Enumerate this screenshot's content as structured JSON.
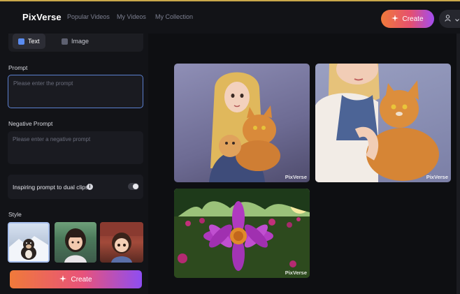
{
  "header": {
    "logo": "PixVerse",
    "nav": [
      "Popular Videos",
      "My Videos",
      "My Collection"
    ],
    "create_label": "Create"
  },
  "mode_tabs": [
    {
      "label": "Text",
      "selected": true
    },
    {
      "label": "Image",
      "selected": false
    }
  ],
  "prompt": {
    "label": "Prompt",
    "placeholder": "Please enter the prompt"
  },
  "negative_prompt": {
    "label": "Negative Prompt",
    "placeholder": "Please enter a negative prompt"
  },
  "inspiring": {
    "label": "Inspiring prompt to dual clips",
    "enabled": false
  },
  "style": {
    "label": "Style"
  },
  "create_button": "Create",
  "gallery": {
    "watermark": "PixVerse"
  },
  "colors": {
    "accent_start": "#f07a3a",
    "accent_end": "#8e4df2",
    "focus_border": "#5b7fcf"
  }
}
